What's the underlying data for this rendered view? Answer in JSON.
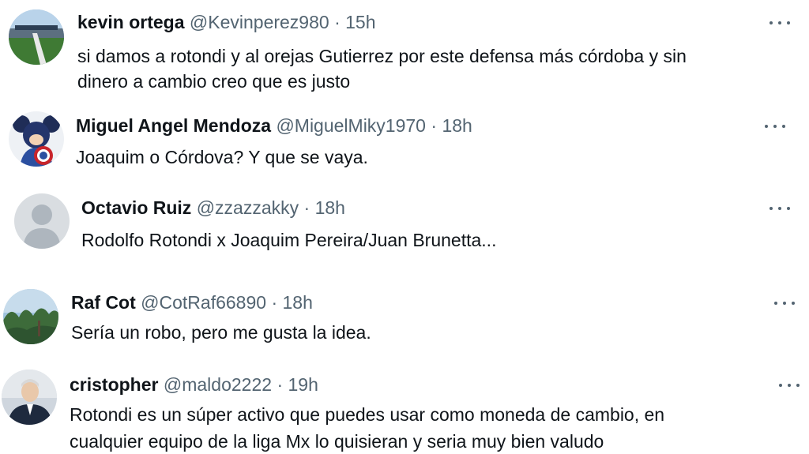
{
  "replies": [
    {
      "name": "kevin ortega",
      "handle": "@Kevinperez980",
      "sep": "·",
      "time": "15h",
      "lines": [
        "si damos a rotondi y al orejas Gutierrez por este defensa más córdoba y sin",
        "dinero a cambio creo que es justo"
      ],
      "avatar_icon": "stadium-photo-avatar"
    },
    {
      "name": "Miguel Angel Mendoza",
      "handle": "@MiguelMiky1970",
      "sep": "·",
      "time": "18h",
      "lines": [
        "Joaquim o Córdova? Y que se vaya."
      ],
      "avatar_icon": "captain-mickey-avatar"
    },
    {
      "name": "Octavio Ruiz",
      "handle": "@zzazzakky",
      "sep": "·",
      "time": "18h",
      "lines": [
        "Rodolfo Rotondi x Joaquim Pereira/Juan Brunetta..."
      ],
      "avatar_icon": "default-user-avatar"
    },
    {
      "name": "Raf Cot",
      "handle": "@CotRaf66890",
      "sep": "·",
      "time": "18h",
      "lines": [
        "Sería un robo, pero me gusta la idea."
      ],
      "avatar_icon": "trees-landscape-avatar"
    },
    {
      "name": "cristopher",
      "handle": "@maldo2222",
      "sep": "·",
      "time": "19h",
      "lines": [
        "Rotondi es un súper activo que puedes usar como moneda de cambio, en",
        "cualquier equipo de la liga Mx lo quisieran y seria muy bien valudo"
      ],
      "avatar_icon": "man-portrait-avatar"
    }
  ],
  "colors": {
    "text": "#0f1419",
    "secondary": "#536471",
    "background": "#ffffff"
  },
  "more_icon": "more-options-icon"
}
